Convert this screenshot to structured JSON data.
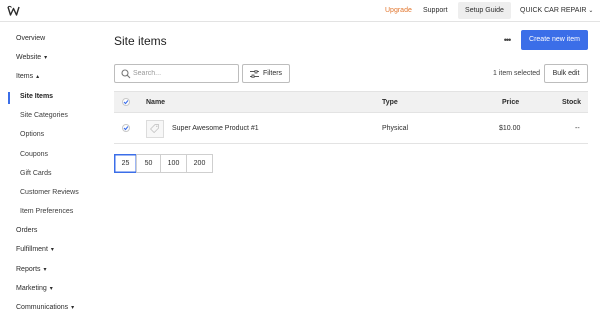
{
  "topbar": {
    "upgrade": "Upgrade",
    "support": "Support",
    "setup_guide": "Setup Guide",
    "site_name": "QUICK CAR REPAIR"
  },
  "sidebar": {
    "items": [
      {
        "label": "Overview",
        "caret": false
      },
      {
        "label": "Website",
        "caret": true
      },
      {
        "label": "Items",
        "caret": true,
        "expanded": true
      },
      {
        "label": "Site Items",
        "sub": true,
        "active": true
      },
      {
        "label": "Site Categories",
        "sub": true
      },
      {
        "label": "Options",
        "sub": true
      },
      {
        "label": "Coupons",
        "sub": true
      },
      {
        "label": "Gift Cards",
        "sub": true
      },
      {
        "label": "Customer Reviews",
        "sub": true
      },
      {
        "label": "Item Preferences",
        "sub": true
      },
      {
        "label": "Orders",
        "caret": false
      },
      {
        "label": "Fulfillment",
        "caret": true
      },
      {
        "label": "Reports",
        "caret": true
      },
      {
        "label": "Marketing",
        "caret": true
      },
      {
        "label": "Communications",
        "caret": true
      }
    ]
  },
  "main": {
    "title": "Site items",
    "create_button": "Create new item",
    "search_placeholder": "Search...",
    "filters_label": "Filters",
    "selected_count": "1 item selected",
    "bulk_edit": "Bulk edit"
  },
  "table": {
    "columns": [
      "Name",
      "Type",
      "Price",
      "Stock"
    ],
    "rows": [
      {
        "name": "Super Awesome Product #1",
        "type": "Physical",
        "price": "$10.00",
        "stock": "--",
        "selected": true
      }
    ]
  },
  "pagination": {
    "sizes": [
      "25",
      "50",
      "100",
      "200"
    ],
    "selected": "25"
  },
  "colors": {
    "accent": "#3b6ee8",
    "upgrade": "#e2762e"
  }
}
